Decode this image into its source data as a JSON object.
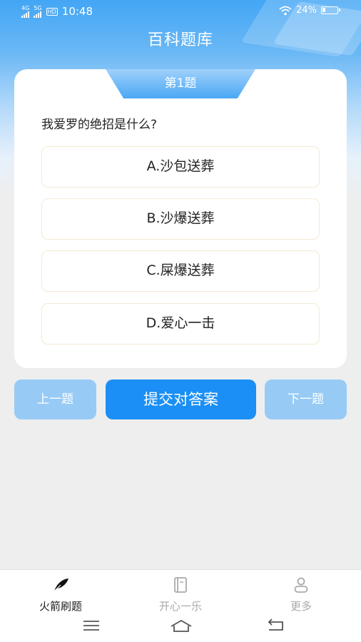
{
  "status_bar": {
    "net1": "4G",
    "net2": "5G",
    "hd": "HD",
    "time": "10:48",
    "battery": "24%"
  },
  "header": {
    "title": "百科题库"
  },
  "quiz": {
    "number_label": "第1题",
    "question": "我爱罗的绝招是什么?",
    "options": [
      {
        "label": "A.沙包送葬"
      },
      {
        "label": "B.沙爆送葬"
      },
      {
        "label": "C.屎爆送葬"
      },
      {
        "label": "D.爱心一击"
      }
    ]
  },
  "actions": {
    "prev": "上一题",
    "submit": "提交对答案",
    "next": "下一题"
  },
  "tabbar": {
    "items": [
      {
        "label": "火箭刷题",
        "icon": "feather-icon",
        "active": true
      },
      {
        "label": "开心一乐",
        "icon": "book-icon",
        "active": false
      },
      {
        "label": "更多",
        "icon": "user-icon",
        "active": false
      }
    ]
  },
  "colors": {
    "accent": "#1b8ff5",
    "side_button": "#97cbf6",
    "option_border": "#f3ead3",
    "tab_active": "#222222",
    "tab_inactive": "#aaaaaa"
  },
  "nav": {
    "icons": [
      "menu-icon",
      "home-icon",
      "back-icon"
    ]
  }
}
